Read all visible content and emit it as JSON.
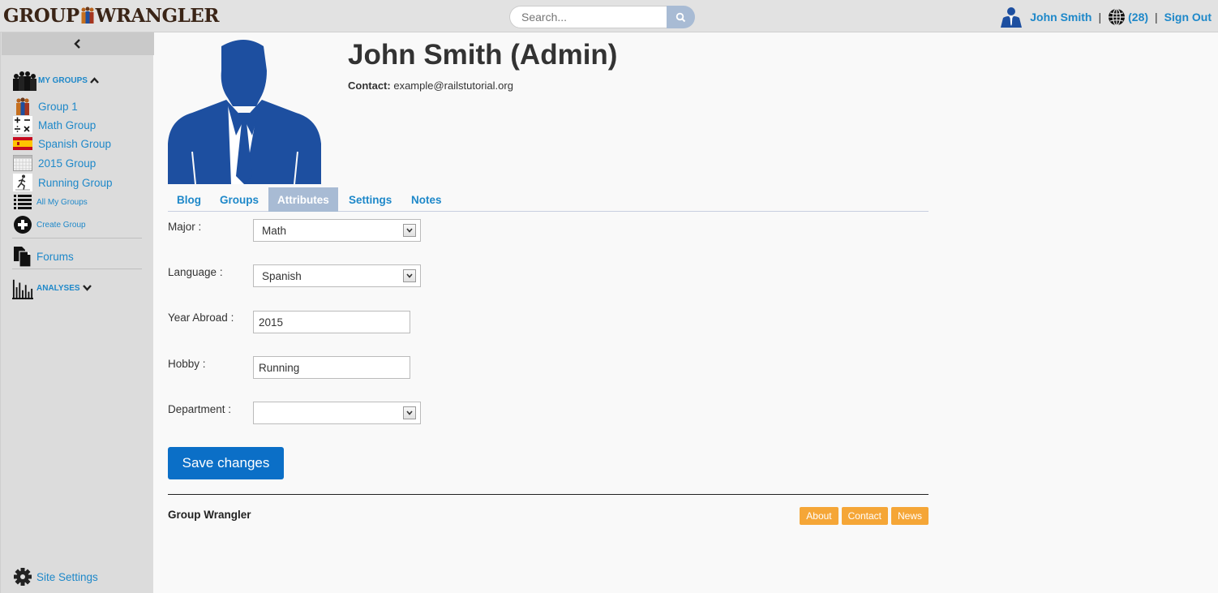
{
  "app": {
    "logo_left": "GROUP",
    "logo_right": "WRANGLER"
  },
  "header": {
    "search_placeholder": "Search...",
    "user_name": "John Smith",
    "notifications": "(28)",
    "sign_out": "Sign Out",
    "separator": "|"
  },
  "sidebar": {
    "my_groups": "MY GROUPS",
    "groups": [
      {
        "label": "Group 1",
        "icon": "group-people-icon"
      },
      {
        "label": "Math Group",
        "icon": "math-symbols-icon"
      },
      {
        "label": "Spanish Group",
        "icon": "spain-flag-icon"
      },
      {
        "label": "2015 Group",
        "icon": "calendar-icon"
      },
      {
        "label": "Running Group",
        "icon": "runner-icon"
      }
    ],
    "all_groups": "All My Groups",
    "create_group": "Create Group",
    "forums": "Forums",
    "analyses": "ANALYSES",
    "site_settings": "Site Settings"
  },
  "profile": {
    "name": "John Smith (Admin)",
    "contact_label": "Contact:",
    "contact_email": "example@railstutorial.org"
  },
  "tabs": [
    "Blog",
    "Groups",
    "Attributes",
    "Settings",
    "Notes"
  ],
  "active_tab": "Attributes",
  "form": {
    "major_label": "Major :",
    "major_value": "Math",
    "language_label": "Language :",
    "language_value": "Spanish",
    "year_label": "Year Abroad :",
    "year_value": "2015",
    "hobby_label": "Hobby :",
    "hobby_value": "Running",
    "department_label": "Department :",
    "department_value": "",
    "save_label": "Save changes"
  },
  "footer": {
    "title": "Group Wrangler",
    "links": [
      "About",
      "Contact",
      "News"
    ]
  },
  "colors": {
    "link": "#1e88c9",
    "accent": "#a8bbd4",
    "primary_button": "#0b6fc7",
    "footer_button": "#f5a637",
    "avatar": "#1d4fa0"
  }
}
